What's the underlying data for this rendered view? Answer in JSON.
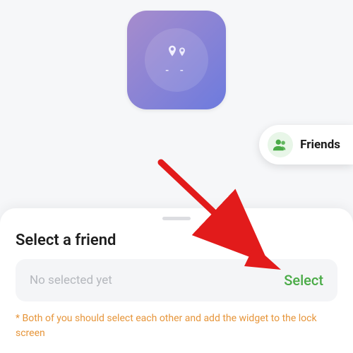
{
  "widget": {
    "dash_text": "- -"
  },
  "friends_pill": {
    "label": "Friends"
  },
  "sheet": {
    "title": "Select a friend",
    "no_selected": "No selected yet",
    "select_label": "Select",
    "note": "* Both of you should select each other and add the widget to the lock screen"
  }
}
